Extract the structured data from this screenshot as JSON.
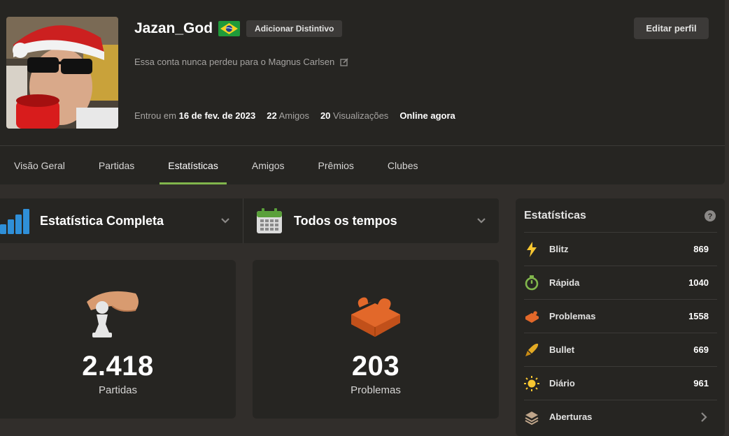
{
  "profile": {
    "username": "Jazan_God",
    "badge_button": "Adicionar Distintivo",
    "edit_button": "Editar perfil",
    "bio": "Essa conta nunca perdeu para o Magnus Carlsen",
    "joined_label": "Entrou em",
    "joined_date": "16 de fev. de 2023",
    "friends_count": "22",
    "friends_label": "Amigos",
    "views_count": "20",
    "views_label": "Visualizações",
    "status": "Online agora"
  },
  "tabs": [
    {
      "label": "Visão Geral"
    },
    {
      "label": "Partidas"
    },
    {
      "label": "Estatísticas",
      "active": true
    },
    {
      "label": "Amigos"
    },
    {
      "label": "Prêmios"
    },
    {
      "label": "Clubes"
    }
  ],
  "filters": {
    "type": "Estatística Completa",
    "period": "Todos os tempos"
  },
  "cards": [
    {
      "value": "2.418",
      "caption": "Partidas"
    },
    {
      "value": "203",
      "caption": "Problemas"
    }
  ],
  "side": {
    "title": "Estatísticas",
    "rows": [
      {
        "name": "Blitz",
        "value": "869",
        "icon": "blitz-icon"
      },
      {
        "name": "Rápida",
        "value": "1040",
        "icon": "rapid-icon"
      },
      {
        "name": "Problemas",
        "value": "1558",
        "icon": "puzzle-icon"
      },
      {
        "name": "Bullet",
        "value": "669",
        "icon": "bullet-icon"
      },
      {
        "name": "Diário",
        "value": "961",
        "icon": "daily-icon"
      },
      {
        "name": "Aberturas",
        "value": "",
        "icon": "openings-icon"
      }
    ]
  },
  "colors": {
    "background": "#312e2b",
    "panel": "#262522",
    "accent_green": "#81b64c"
  }
}
